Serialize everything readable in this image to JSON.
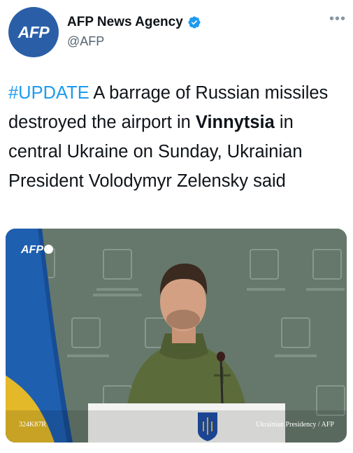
{
  "account": {
    "avatar_text": "AFP",
    "display_name": "AFP News Agency",
    "handle": "@AFP",
    "verified_icon": "verified-badge-icon",
    "more_icon": "more-horizontal-icon"
  },
  "tweet": {
    "hashtag": "#UPDATE",
    "text_part1": " A barrage of Russian missiles destroyed the airport in ",
    "bold_place": "Vinnytsia",
    "text_part2": " in central Ukraine on Sunday, Ukrainian President Volodymyr Zelensky said"
  },
  "media": {
    "watermark": "AFP",
    "credit_left": "324K87R",
    "credit_right": "Ukrainian Presidency / AFP"
  },
  "colors": {
    "link": "#1d9bf0",
    "avatar_bg": "#2a5fa8",
    "verified": "#1d9bf0"
  }
}
